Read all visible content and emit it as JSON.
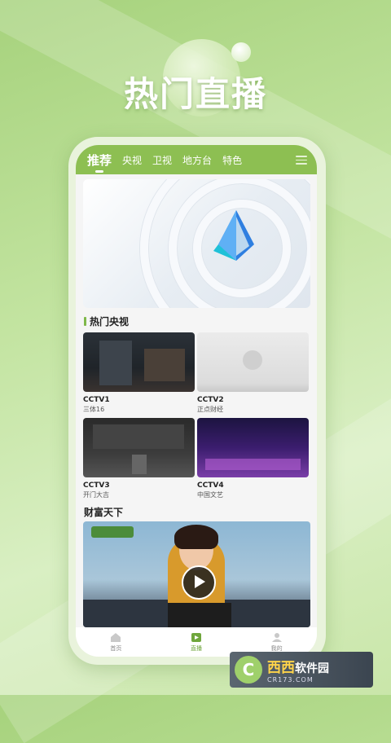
{
  "hero": {
    "title": "热门直播"
  },
  "tabs": [
    {
      "label": "推荐",
      "active": true
    },
    {
      "label": "央视",
      "active": false
    },
    {
      "label": "卫视",
      "active": false
    },
    {
      "label": "地方台",
      "active": false
    },
    {
      "label": "特色",
      "active": false
    }
  ],
  "menu_icon": "menu-icon",
  "section_cctv": {
    "title": "热门央视",
    "cards": [
      {
        "name": "CCTV1",
        "program": "三体16"
      },
      {
        "name": "CCTV2",
        "program": "正点财经"
      },
      {
        "name": "CCTV3",
        "program": "开门大吉"
      },
      {
        "name": "CCTV4",
        "program": "中国文艺"
      }
    ]
  },
  "section_wealth": {
    "title": "财富天下"
  },
  "bottom_nav": [
    {
      "label": "首页",
      "icon": "home-icon",
      "active": false
    },
    {
      "label": "直播",
      "icon": "live-icon",
      "active": true
    },
    {
      "label": "我的",
      "icon": "profile-icon",
      "active": false
    }
  ],
  "watermark": {
    "brand": "西西",
    "suffix": "软件园",
    "url": "CR173.COM"
  },
  "colors": {
    "accent": "#8dbf52",
    "active_nav": "#6fa63c"
  }
}
